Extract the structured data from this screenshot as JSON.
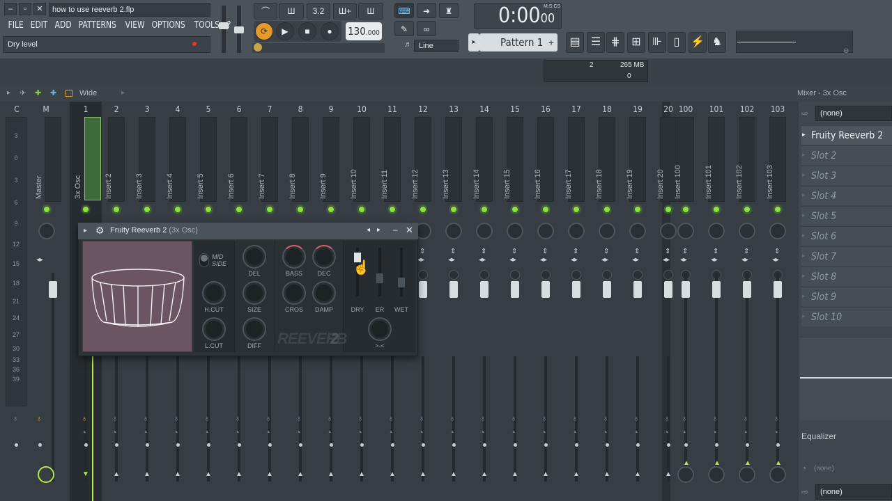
{
  "window": {
    "title": "how to use reeverb 2.flp",
    "controls": [
      "–",
      "▫",
      "✕"
    ]
  },
  "menu": [
    "FILE",
    "EDIT",
    "ADD",
    "PATTERNS",
    "VIEW",
    "OPTIONS",
    "TOOLS",
    "?"
  ],
  "hint_bar": {
    "text": "Dry level"
  },
  "toolbar": {
    "snap_buttons": [
      "⌒",
      "Ш",
      "3.2",
      "Ш+",
      "Ш"
    ],
    "tempo": "130",
    "tempo_decimal": ".000",
    "time": "0:00",
    "time_sub": "00",
    "time_unit": "M:S:CS",
    "pattern": "Pattern 1",
    "pattern_add": "+",
    "line_mode": "Line",
    "cpu": {
      "value1": "2",
      "memory": "265 MB",
      "value2": "0"
    }
  },
  "mixer": {
    "view_mode": "Wide",
    "title": "Mixer - 3x Osc",
    "header_labels": [
      "C",
      "M"
    ],
    "tracks": [
      {
        "num": "1",
        "label": "3x Osc"
      },
      {
        "num": "2",
        "label": "Insert 2"
      },
      {
        "num": "3",
        "label": "Insert 3"
      },
      {
        "num": "4",
        "label": "Insert 4"
      },
      {
        "num": "5",
        "label": "Insert 5"
      },
      {
        "num": "6",
        "label": "Insert 6"
      },
      {
        "num": "7",
        "label": "Insert 7"
      },
      {
        "num": "8",
        "label": "Insert 8"
      },
      {
        "num": "9",
        "label": "Insert 9"
      },
      {
        "num": "10",
        "label": "Insert 10"
      },
      {
        "num": "11",
        "label": "Insert 11"
      },
      {
        "num": "12",
        "label": "Insert 12"
      },
      {
        "num": "13",
        "label": "Insert 13"
      },
      {
        "num": "14",
        "label": "Insert 14"
      },
      {
        "num": "15",
        "label": "Insert 15"
      },
      {
        "num": "16",
        "label": "Insert 16"
      },
      {
        "num": "17",
        "label": "Insert 17"
      },
      {
        "num": "18",
        "label": "Insert 18"
      },
      {
        "num": "19",
        "label": "Insert 19"
      },
      {
        "num": "20",
        "label": "Insert 20"
      }
    ],
    "master_label": "Master",
    "right_tracks": [
      {
        "num": "100",
        "label": "Insert 100"
      },
      {
        "num": "101",
        "label": "Insert 101"
      },
      {
        "num": "102",
        "label": "Insert 102"
      },
      {
        "num": "103",
        "label": "Insert 103"
      }
    ],
    "ruler_ticks": [
      "3",
      "0",
      "3",
      "6",
      "9",
      "12",
      "15",
      "18",
      "21",
      "24",
      "27",
      "30",
      "33",
      "36",
      "39"
    ]
  },
  "fx_panel": {
    "input": "(none)",
    "slots": [
      {
        "label": "Fruity Reeverb 2",
        "active": true
      },
      {
        "label": "Slot 2",
        "active": false
      },
      {
        "label": "Slot 3",
        "active": false
      },
      {
        "label": "Slot 4",
        "active": false
      },
      {
        "label": "Slot 5",
        "active": false
      },
      {
        "label": "Slot 6",
        "active": false
      },
      {
        "label": "Slot 7",
        "active": false
      },
      {
        "label": "Slot 8",
        "active": false
      },
      {
        "label": "Slot 9",
        "active": false
      },
      {
        "label": "Slot 10",
        "active": false
      }
    ],
    "eq_label": "Equalizer",
    "output_none": "(none)",
    "output": "(none)"
  },
  "plugin": {
    "name": "Fruity Reeverb 2",
    "source": "(3x Osc)",
    "mid_side": "MID\nSIDE",
    "knobs": {
      "hcut": "H.CUT",
      "lcut": "L.CUT",
      "del": "DEL",
      "size": "SIZE",
      "diff": "DIFF",
      "bass": "BASS",
      "dec": "DEC",
      "cros": "CROS",
      "damp": "DAMP",
      "stereo": ">-<"
    },
    "sliders": {
      "dry": "DRY",
      "er": "ER",
      "wet": "WET"
    },
    "logo_word": "REEVERB",
    "logo_num": "2"
  },
  "colors": {
    "accent_green": "#8fe04a",
    "record": "#e33"
  }
}
